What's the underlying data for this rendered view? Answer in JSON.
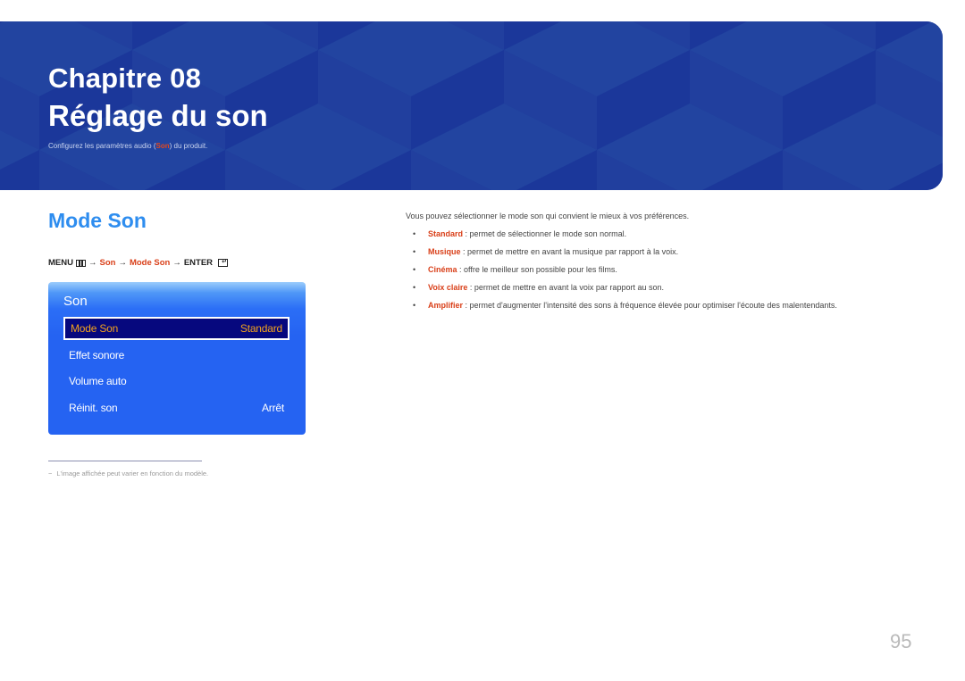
{
  "banner": {
    "chapter": "Chapitre 08",
    "title": "Réglage du son",
    "subtitle_before": "Configurez les paramètres audio (",
    "subtitle_highlight": "Son",
    "subtitle_after": ") du produit.",
    "colors": {
      "background": "#1e3f9c",
      "highlight": "#e2481d"
    }
  },
  "section": {
    "title": "Mode Son",
    "menu_path": {
      "menu": "MENU",
      "menu_icon": "menu-grid-icon",
      "arrow": "→",
      "son": "Son",
      "mode_son": "Mode Son",
      "enter": "ENTER",
      "enter_icon": "enter-icon",
      "enter_glyph": "↵"
    }
  },
  "osd": {
    "title": "Son",
    "items": [
      {
        "label": "Mode Son",
        "value": "Standard",
        "selected": true
      },
      {
        "label": "Effet sonore",
        "value": ""
      },
      {
        "label": "Volume auto",
        "value": ""
      },
      {
        "label": "Réinit. son",
        "value": "Arrêt"
      }
    ],
    "colors": {
      "panel": "#2563f2",
      "selected_bg": "#06087e",
      "selected_text": "#f3a21d"
    }
  },
  "footnote": {
    "dash": "−",
    "text": "L'image affichée peut varier en fonction du modèle."
  },
  "description": {
    "intro": "Vous pouvez sélectionner le mode son qui convient le mieux à vos préférences.",
    "bullet_glyph": "•",
    "items": [
      {
        "term": "Standard",
        "text": " : permet de sélectionner le mode son normal."
      },
      {
        "term": "Musique",
        "text": " : permet de mettre en avant la musique par rapport à la voix."
      },
      {
        "term": "Cinéma",
        "text": " : offre le meilleur son possible pour les films."
      },
      {
        "term": "Voix claire",
        "text": " : permet de mettre en avant la voix par rapport au son."
      },
      {
        "term": "Amplifier",
        "text": " : permet d'augmenter l'intensité des sons à fréquence élevée pour optimiser l'écoute des malentendants."
      }
    ]
  },
  "page_number": "95"
}
